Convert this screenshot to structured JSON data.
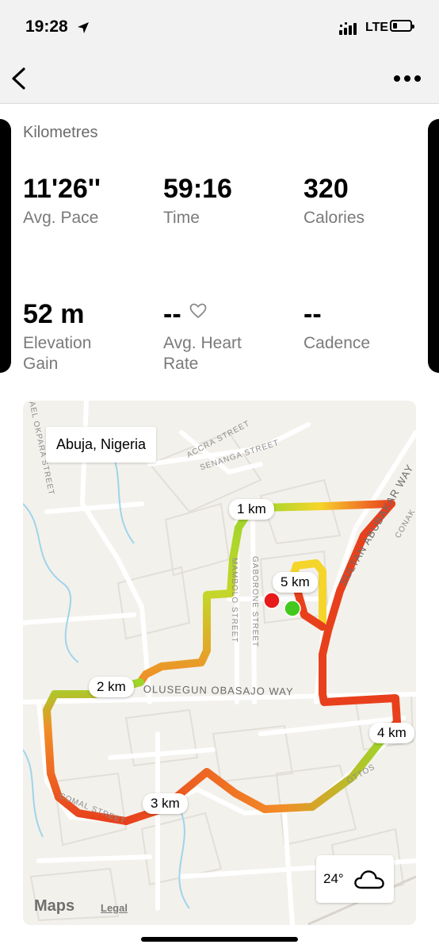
{
  "status_bar": {
    "time": "19:28",
    "network": "LTE"
  },
  "header": {
    "back_icon": "chevron-left-icon",
    "more_icon": "ellipsis-icon"
  },
  "unit_label": "Kilometres",
  "stats": [
    {
      "value": "11'26''",
      "label": "Avg. Pace"
    },
    {
      "value": "59:16",
      "label": "Time"
    },
    {
      "value": "320",
      "label": "Calories"
    },
    {
      "value": "52 m",
      "label_line1": "Elevation",
      "label_line2": "Gain"
    },
    {
      "value": "--",
      "label_line1": "Avg. Heart",
      "label_line2": "Rate",
      "icon": "heart-icon"
    },
    {
      "value": "--",
      "label": "Cadence"
    }
  ],
  "map": {
    "location": "Abuja, Nigeria",
    "km_markers": [
      "1 km",
      "2 km",
      "3 km",
      "4 km",
      "5 km"
    ],
    "streets": [
      "AEL OKPARA STREET",
      "ACCRA STREET",
      "SENANGA STREET",
      "SULTAN ABUBAKAR WAY",
      "CONAK",
      "MAMBOLO STREET",
      "GABORONE STREET",
      "OLUSEGUN OBASAJO WAY",
      "COMAL STREET",
      "OTTOS"
    ],
    "weather": {
      "temp": "24°",
      "icon": "cloud-icon"
    },
    "attribution": {
      "brand": "Maps",
      "legal": "Legal"
    },
    "route_colors": {
      "slow": "#e8401c",
      "medium": "#f28c28",
      "fast": "#9ed52a"
    },
    "start_color": "#43c91e",
    "end_color": "#e81a1a"
  }
}
